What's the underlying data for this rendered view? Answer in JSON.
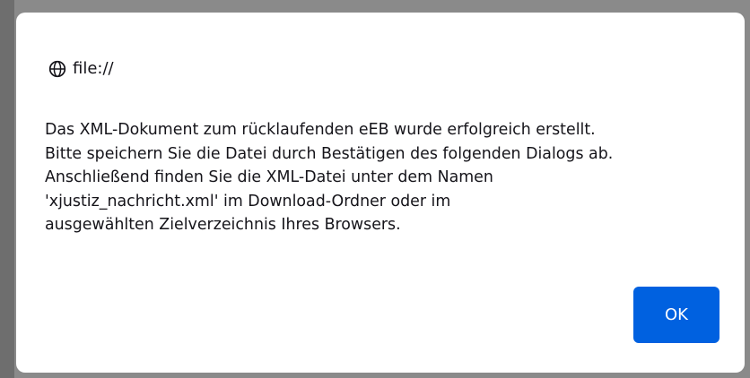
{
  "dialog": {
    "origin": {
      "icon": "globe-icon",
      "label": "file://"
    },
    "message_lines": [
      "Das XML-Dokument zum rücklaufenden eEB wurde erfolgreich erstellt.",
      "Bitte speichern Sie die Datei durch Bestätigen des folgenden Dialogs ab.",
      "Anschließend finden Sie die XML-Datei unter dem Namen",
      "'xjustiz_nachricht.xml' im Download-Ordner oder im",
      "ausgewählten Zielverzeichnis Ihres Browsers."
    ],
    "ok_label": "OK"
  },
  "colors": {
    "backdrop": "#8a8a8a",
    "dialog_background": "#ffffff",
    "accent": "#0061e0",
    "text": "#15141a"
  }
}
